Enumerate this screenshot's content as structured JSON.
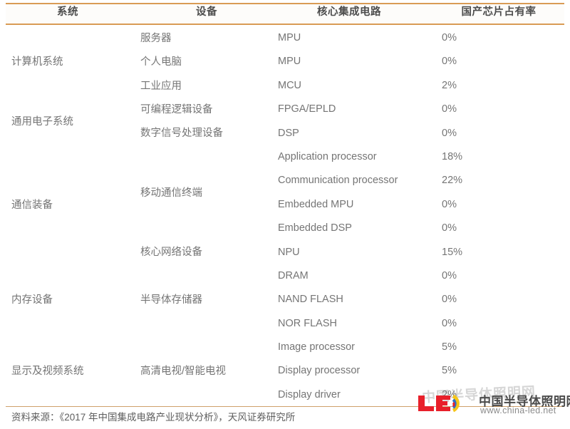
{
  "figure": {
    "columns": [
      {
        "key": "system",
        "label": "系统"
      },
      {
        "key": "device",
        "label": "设备"
      },
      {
        "key": "ic",
        "label": "核心集成电路"
      },
      {
        "key": "rate",
        "label": "国产芯片占有率"
      }
    ],
    "rows": [
      {
        "ic": "MPU",
        "rate": "0%"
      },
      {
        "ic": "MPU",
        "rate": "0%"
      },
      {
        "ic": "MCU",
        "rate": "2%"
      },
      {
        "ic": "FPGA/EPLD",
        "rate": "0%"
      },
      {
        "ic": "DSP",
        "rate": "0%"
      },
      {
        "ic": "Application processor",
        "rate": "18%"
      },
      {
        "ic": "Communication processor",
        "rate": "22%"
      },
      {
        "ic": "Embedded MPU",
        "rate": "0%"
      },
      {
        "ic": "Embedded DSP",
        "rate": "0%"
      },
      {
        "ic": "NPU",
        "rate": "15%"
      },
      {
        "ic": "DRAM",
        "rate": "0%"
      },
      {
        "ic": "NAND FLASH",
        "rate": "0%"
      },
      {
        "ic": "NOR FLASH",
        "rate": "0%"
      },
      {
        "ic": "Image processor",
        "rate": "5%"
      },
      {
        "ic": "Display processor",
        "rate": "5%"
      },
      {
        "ic": "Display driver",
        "rate": "2%"
      }
    ],
    "system_groups": [
      {
        "label": "计算机系统",
        "start": 0,
        "span": 3
      },
      {
        "label": "通用电子系统",
        "start": 3,
        "span": 2
      },
      {
        "label": "通信装备",
        "start": 5,
        "span": 5
      },
      {
        "label": "内存设备",
        "start": 10,
        "span": 3
      },
      {
        "label": "显示及视频系统",
        "start": 13,
        "span": 3
      }
    ],
    "device_groups": [
      {
        "label": "服务器",
        "start": 0,
        "span": 1
      },
      {
        "label": "个人电脑",
        "start": 1,
        "span": 1
      },
      {
        "label": "工业应用",
        "start": 2,
        "span": 1
      },
      {
        "label": "可编程逻辑设备",
        "start": 3,
        "span": 1
      },
      {
        "label": "数字信号处理设备",
        "start": 4,
        "span": 1
      },
      {
        "label": "移动通信终端",
        "start": 5,
        "span": 4
      },
      {
        "label": "核心网络设备",
        "start": 9,
        "span": 1
      },
      {
        "label": "半导体存储器",
        "start": 10,
        "span": 3
      },
      {
        "label": "高清电视/智能电视",
        "start": 13,
        "span": 3
      }
    ],
    "source_note": "资料来源：《2017 年中国集成电路产业现状分析》，天风证券研究所",
    "accent_color": "#d99b55",
    "text_color": "#757575",
    "header_text_color": "#4d4d4d"
  },
  "watermark": {
    "logo_text": "LED",
    "site_name": "中国半导体照明网",
    "site_url": "www.china-led.net",
    "ghost_text": "中国半导体照明网"
  }
}
